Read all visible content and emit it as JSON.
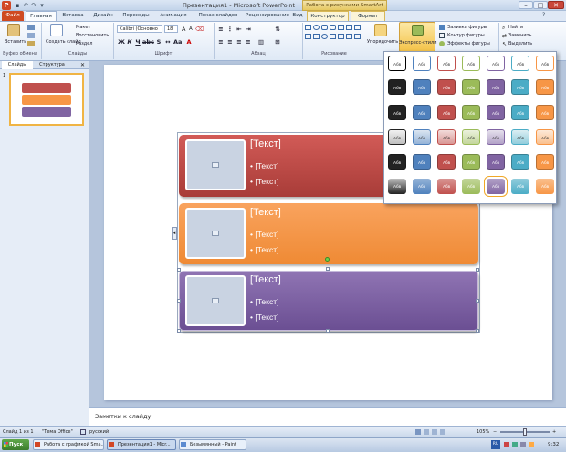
{
  "window": {
    "title": "Презентация1 - Microsoft PowerPoint",
    "context_band": "Работа с рисунками SmartArt",
    "qat": [
      "save-icon",
      "undo-icon",
      "redo-icon",
      "dropdown-icon"
    ]
  },
  "tabs": [
    "Файл",
    "Главная",
    "Вставка",
    "Дизайн",
    "Переходы",
    "Анимация",
    "Показ слайдов",
    "Рецензирование",
    "Вид",
    "Конструктор",
    "Формат"
  ],
  "ribbon": {
    "paste": "Вставить",
    "clipboard_group": "Буфер обмена",
    "new_slide": "Создать слайд",
    "layout": "Макет",
    "reset": "Восстановить",
    "section": "Раздел",
    "slides_group": "Слайды",
    "font_name": "Calibri (Основно",
    "font_size": "18",
    "font_group": "Шрифт",
    "paragraph_group": "Абзац",
    "drawing_group": "Рисование",
    "arrange": "Упорядочить",
    "express_styles": "Экспресс-стили",
    "shape_fill": "Заливка фигуры",
    "shape_outline": "Контур фигуры",
    "shape_effects": "Эффекты фигуры",
    "find": "Найти",
    "replace": "Заменить",
    "select": "Выделить"
  },
  "panel": {
    "tab_slides": "Слайды",
    "tab_outline": "Структура",
    "slide_number": "1"
  },
  "smartart": {
    "rows": [
      {
        "title": "[Текст]",
        "bullets": [
          "[Текст]",
          "[Текст]"
        ],
        "color": "#c0504d"
      },
      {
        "title": "[Текст]",
        "bullets": [
          "[Текст]",
          "[Текст]"
        ],
        "color": "#f79646"
      },
      {
        "title": "[Текст]",
        "bullets": [
          "[Текст]",
          "[Текст]"
        ],
        "color": "#8064a2"
      }
    ]
  },
  "gallery": {
    "swatch_label": "Абв",
    "colors": [
      "#222222",
      "#4f81bd",
      "#c0504d",
      "#9bbb59",
      "#8064a2",
      "#4bacc6",
      "#f79646"
    ],
    "selected": "row6-col5"
  },
  "notes": {
    "placeholder": "Заметки к слайду"
  },
  "status": {
    "slide": "Слайд 1 из 1",
    "theme": "\"Тема Office\"",
    "language": "русский",
    "zoom": "105%"
  },
  "taskbar": {
    "start": "Пуск",
    "items": [
      "Работа с графикой Sma...",
      "Презентация1 - Micr...",
      "Безымянный - Paint"
    ],
    "lang": "RU",
    "clock": "9:32"
  }
}
